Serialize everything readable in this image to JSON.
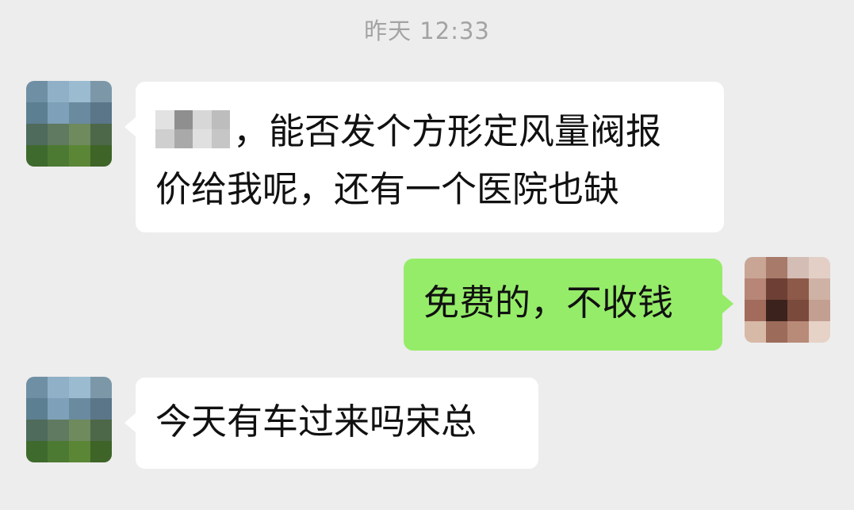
{
  "timestamp": "昨天 12:33",
  "messages": [
    {
      "side": "left",
      "line1": "，能否发个方形定风量阀报",
      "line2": "价给我呢，还有一个医院也缺"
    },
    {
      "side": "right",
      "text": "免费的，不收钱"
    },
    {
      "side": "left",
      "text": "今天有车过来吗宋总"
    }
  ],
  "colors": {
    "background": "#ededed",
    "incoming_bubble": "#ffffff",
    "outgoing_bubble": "#95ec69",
    "timestamp_text": "#a3a3a3"
  },
  "icons": [
    "blurred-contact-avatar",
    "blurred-user-avatar",
    "redacted-name-mosaic"
  ]
}
